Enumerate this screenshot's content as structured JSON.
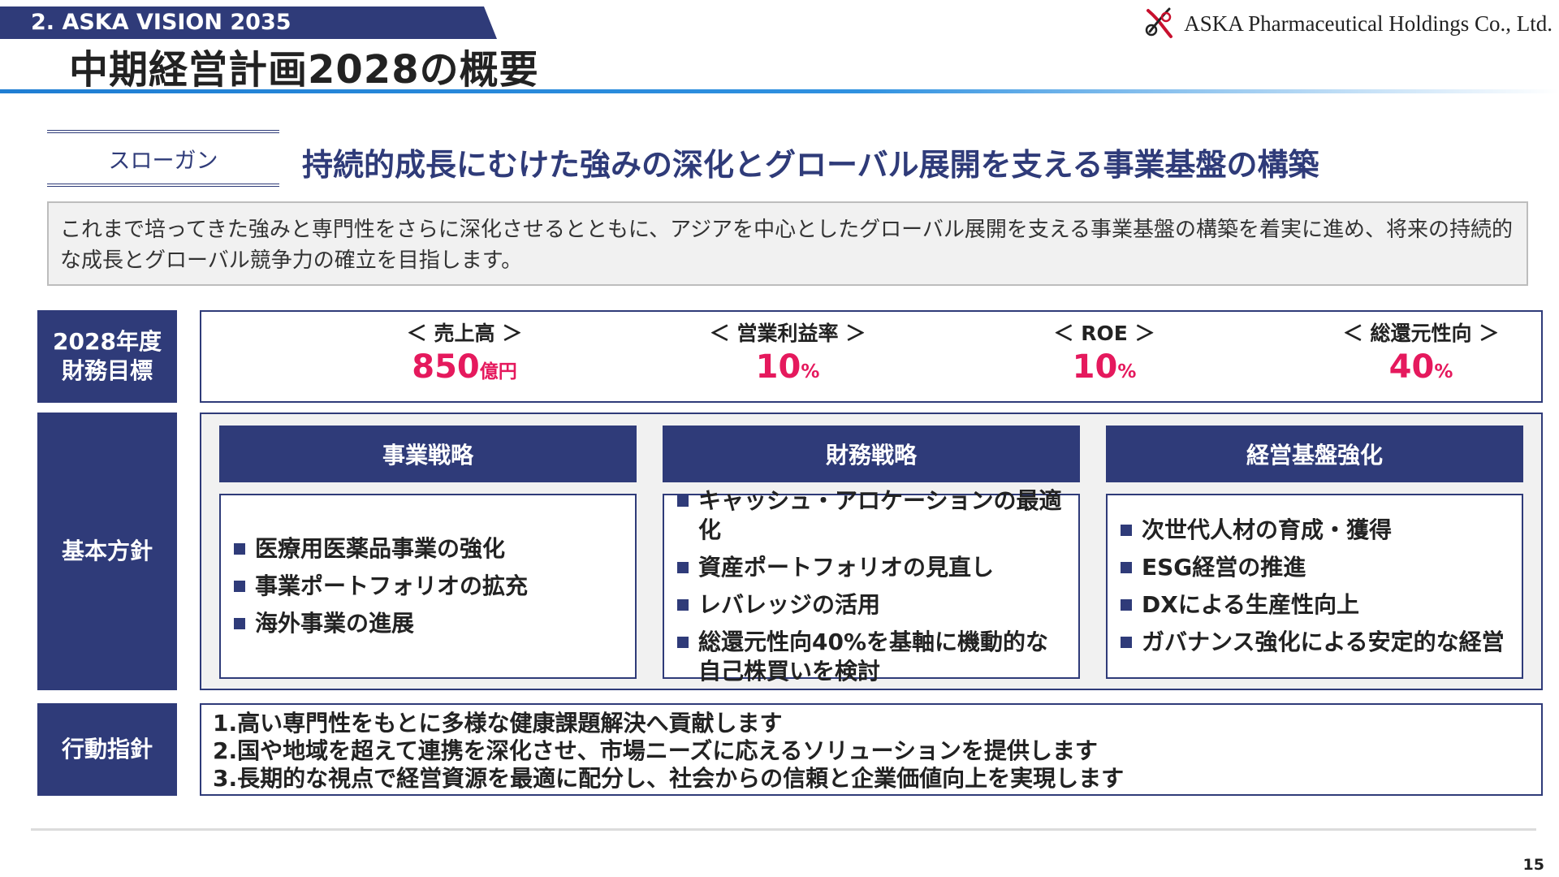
{
  "header": {
    "section_tab": "2. ASKA VISION 2035",
    "page_title": "中期経営計画2028の概要",
    "company": "ASKA Pharmaceutical Holdings Co., Ltd."
  },
  "slogan": {
    "label": "スローガン",
    "text": "持続的成長にむけた強みの深化とグローバル展開を支える事業基盤の構築"
  },
  "intro": "これまで培ってきた強みと専門性をさらに深化させるとともに、アジアを中心としたグローバル展開を支える事業基盤の構築を着実に進め、将来の持続的な成長とグローバル競争力の確立を目指します。",
  "financial": {
    "label_line1": "2028年度",
    "label_line2": "財務目標",
    "kpis": [
      {
        "label": "＜ 売上高 ＞",
        "value": "850",
        "unit": "億円"
      },
      {
        "label": "＜ 営業利益率 ＞",
        "value": "10",
        "unit": "%"
      },
      {
        "label": "＜ ROE ＞",
        "value": "10",
        "unit": "%"
      },
      {
        "label": "＜ 総還元性向 ＞",
        "value": "40",
        "unit": "%"
      }
    ]
  },
  "policy": {
    "label": "基本方針",
    "columns": [
      {
        "title": "事業戦略",
        "items": [
          "医療用医薬品事業の強化",
          "事業ポートフォリオの拡充",
          "海外事業の進展"
        ]
      },
      {
        "title": "財務戦略",
        "items": [
          "キャッシュ・アロケーションの最適化",
          "資産ポートフォリオの見直し",
          "レバレッジの活用",
          "総還元性向40%を基軸に機動的な自己株買いを検討"
        ]
      },
      {
        "title": "経営基盤強化",
        "items": [
          "次世代人材の育成・獲得",
          "ESG経営の推進",
          "DXによる生産性向上",
          "ガバナンス強化による安定的な経営"
        ]
      }
    ]
  },
  "action": {
    "label": "行動指針",
    "items": [
      "1.高い専門性をもとに多様な健康課題解決へ貢献します",
      "2.国や地域を超えて連携を深化させ、市場ニーズに応えるソリューションを提供します",
      "3.長期的な視点で経営資源を最適に配分し、社会からの信頼と企業価値向上を実現します"
    ]
  },
  "page_number": "15",
  "colors": {
    "navy": "#2f3b79",
    "accent_pink": "#e5195d",
    "title_rule_blue": "#1f7ed3",
    "logo_red": "#c8102e"
  }
}
